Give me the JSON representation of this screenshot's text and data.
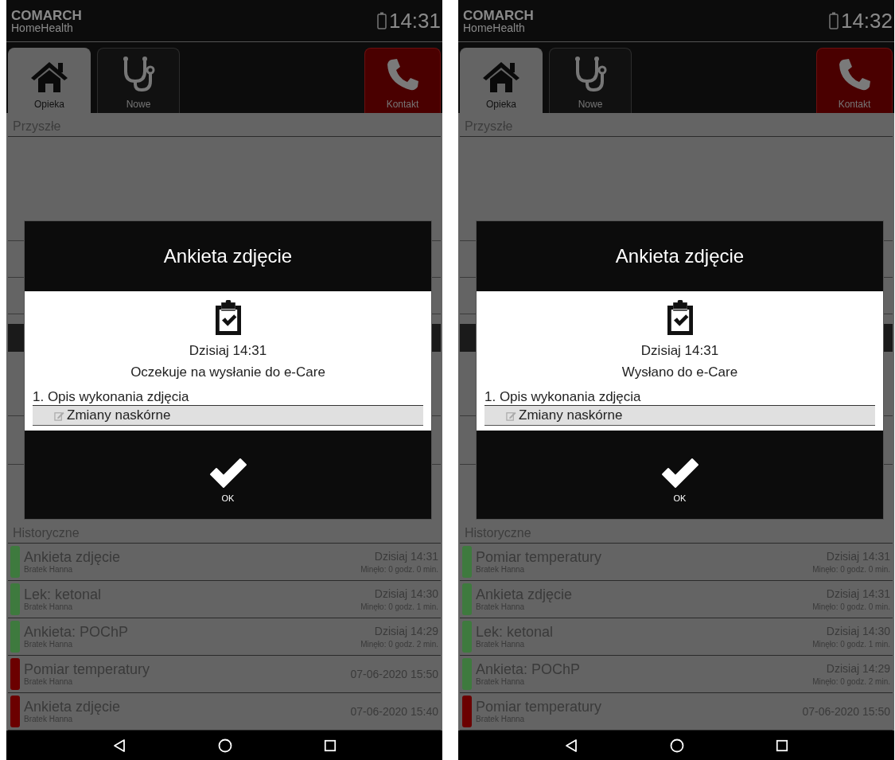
{
  "screens": [
    {
      "brand": {
        "name": "COMARCH",
        "product": "HomeHealth"
      },
      "clock": "14:31",
      "tabs": [
        {
          "kind": "care",
          "label": "Opieka",
          "selected": true
        },
        {
          "kind": "new",
          "label": "Nowe",
          "selected": false
        },
        {
          "kind": "contact",
          "label": "Kontakt",
          "selected": false
        }
      ],
      "upcoming": {
        "title": "Przyszłe"
      },
      "dialog": {
        "title": "Ankieta zdjęcie",
        "date": "Dzisiaj 14:31",
        "status": "Oczekuje na wysłanie do e-Care",
        "question": "1. Opis wykonania zdjęcia",
        "answer": "Zmiany naskórne",
        "button": "OK"
      },
      "history": {
        "title": "Historyczne",
        "items": [
          {
            "title": "Ankieta zdjęcie",
            "patient": "Bratek Hanna",
            "date": "Dzisiaj 14:31",
            "elapsed": "Minęło: 0 godz. 0 min.",
            "color": "#3e7a3e"
          },
          {
            "title": "Lek: ketonal",
            "patient": "Bratek Hanna",
            "date": "Dzisiaj 14:30",
            "elapsed": "Minęło: 0 godz. 1 min.",
            "color": "#3e7a3e"
          },
          {
            "title": "Ankieta: POChP",
            "patient": "Bratek Hanna",
            "date": "Dzisiaj 14:29",
            "elapsed": "Minęło: 0 godz. 2 min.",
            "color": "#3e7a3e"
          },
          {
            "title": "Pomiar temperatury",
            "patient": "Bratek Hanna",
            "date": "07-06-2020 15:50",
            "color": "#6b0000"
          },
          {
            "title": "Ankieta zdjęcie",
            "patient": "Bratek Hanna",
            "date": "07-06-2020 15:40",
            "color": "#6b0000"
          }
        ]
      }
    },
    {
      "brand": {
        "name": "COMARCH",
        "product": "HomeHealth"
      },
      "clock": "14:32",
      "tabs": [
        {
          "kind": "care",
          "label": "Opieka",
          "selected": true
        },
        {
          "kind": "new",
          "label": "Nowe",
          "selected": false
        },
        {
          "kind": "contact",
          "label": "Kontakt",
          "selected": false
        }
      ],
      "upcoming": {
        "title": "Przyszłe"
      },
      "dialog": {
        "title": "Ankieta zdjęcie",
        "date": "Dzisiaj 14:31",
        "status": "Wysłano do e-Care",
        "question": "1. Opis wykonania zdjęcia",
        "answer": "Zmiany naskórne",
        "button": "OK"
      },
      "history": {
        "title": "Historyczne",
        "items": [
          {
            "title": "Pomiar temperatury",
            "patient": "Bratek Hanna",
            "date": "Dzisiaj 14:31",
            "elapsed": "Minęło: 0 godz. 0 min.",
            "color": "#3e7a3e"
          },
          {
            "title": "Ankieta zdjęcie",
            "patient": "Bratek Hanna",
            "date": "Dzisiaj 14:31",
            "elapsed": "Minęło: 0 godz. 0 min.",
            "color": "#3e7a3e"
          },
          {
            "title": "Lek: ketonal",
            "patient": "Bratek Hanna",
            "date": "Dzisiaj 14:30",
            "elapsed": "Minęło: 0 godz. 1 min.",
            "color": "#3e7a3e"
          },
          {
            "title": "Ankieta: POChP",
            "patient": "Bratek Hanna",
            "date": "Dzisiaj 14:29",
            "elapsed": "Minęło: 0 godz. 2 min.",
            "color": "#3e7a3e"
          },
          {
            "title": "Pomiar temperatury",
            "patient": "Bratek Hanna",
            "date": "07-06-2020 15:50",
            "color": "#6b0000"
          }
        ]
      }
    }
  ]
}
